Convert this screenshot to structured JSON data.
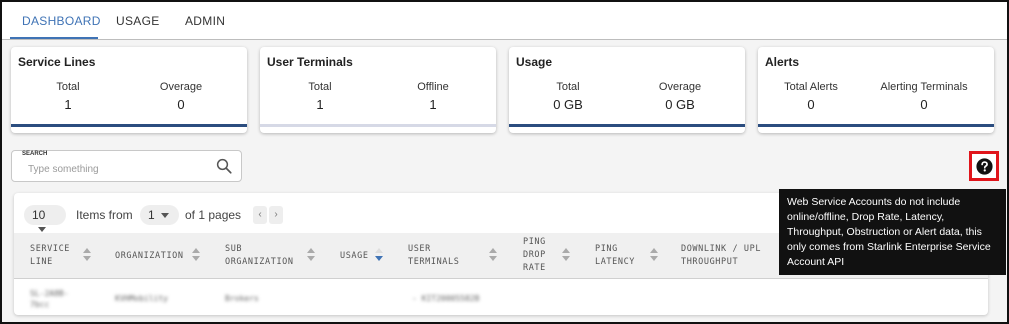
{
  "tabs": [
    {
      "label": "DASHBOARD",
      "active": true
    },
    {
      "label": "USAGE",
      "active": false
    },
    {
      "label": "ADMIN",
      "active": false
    }
  ],
  "cards": [
    {
      "title": "Service Lines",
      "stats": [
        {
          "label": "Total",
          "value": "1"
        },
        {
          "label": "Overage",
          "value": "0"
        }
      ],
      "bar": "full"
    },
    {
      "title": "User Terminals",
      "stats": [
        {
          "label": "Total",
          "value": "1"
        },
        {
          "label": "Offline",
          "value": "1"
        }
      ],
      "bar": "light"
    },
    {
      "title": "Usage",
      "stats": [
        {
          "label": "Total",
          "value": "0 GB"
        },
        {
          "label": "Overage",
          "value": "0 GB"
        }
      ],
      "bar": "full"
    },
    {
      "title": "Alerts",
      "stats": [
        {
          "label": "Total Alerts",
          "value": "0"
        },
        {
          "label": "Alerting Terminals",
          "value": "0"
        }
      ],
      "bar": "full"
    }
  ],
  "search": {
    "label": "SEARCH",
    "placeholder": "Type something",
    "icon": "search-icon"
  },
  "help": {
    "icon": "question-circle-icon",
    "highlight_color": "#e0151b"
  },
  "tooltip": {
    "text": "Web Service Accounts do not include online/offline, Drop Rate, Latency, Throughput, Obstruction or Alert data, this only comes from Starlink Enterprise Service Account API"
  },
  "pager": {
    "page_size": "10",
    "items_from_label": "Items from",
    "current_page": "1",
    "of_pages": "of 1 pages"
  },
  "table": {
    "columns": [
      {
        "label": "SERVICE LINE"
      },
      {
        "label": "ORGANIZATION"
      },
      {
        "label": "SUB ORGANIZATION"
      },
      {
        "label": "USAGE",
        "sorted": "desc"
      },
      {
        "label": "USER TERMINALS"
      },
      {
        "label": "PING DROP RATE"
      },
      {
        "label": "PING LATENCY"
      },
      {
        "label": "DOWNLINK / UPL"
      },
      {
        "label": "THROUGHPUT"
      }
    ],
    "rows": [
      {
        "service_line": "SL-2A8B-7bcc",
        "organization": "KVHMobility",
        "sub_organization": "Brokers",
        "usage": "",
        "user_terminals": "- KIT20005582B"
      }
    ]
  },
  "colors": {
    "accent": "#3f73b5",
    "card_bar": "#2b4d7f",
    "tooltip_bg": "#111111"
  }
}
